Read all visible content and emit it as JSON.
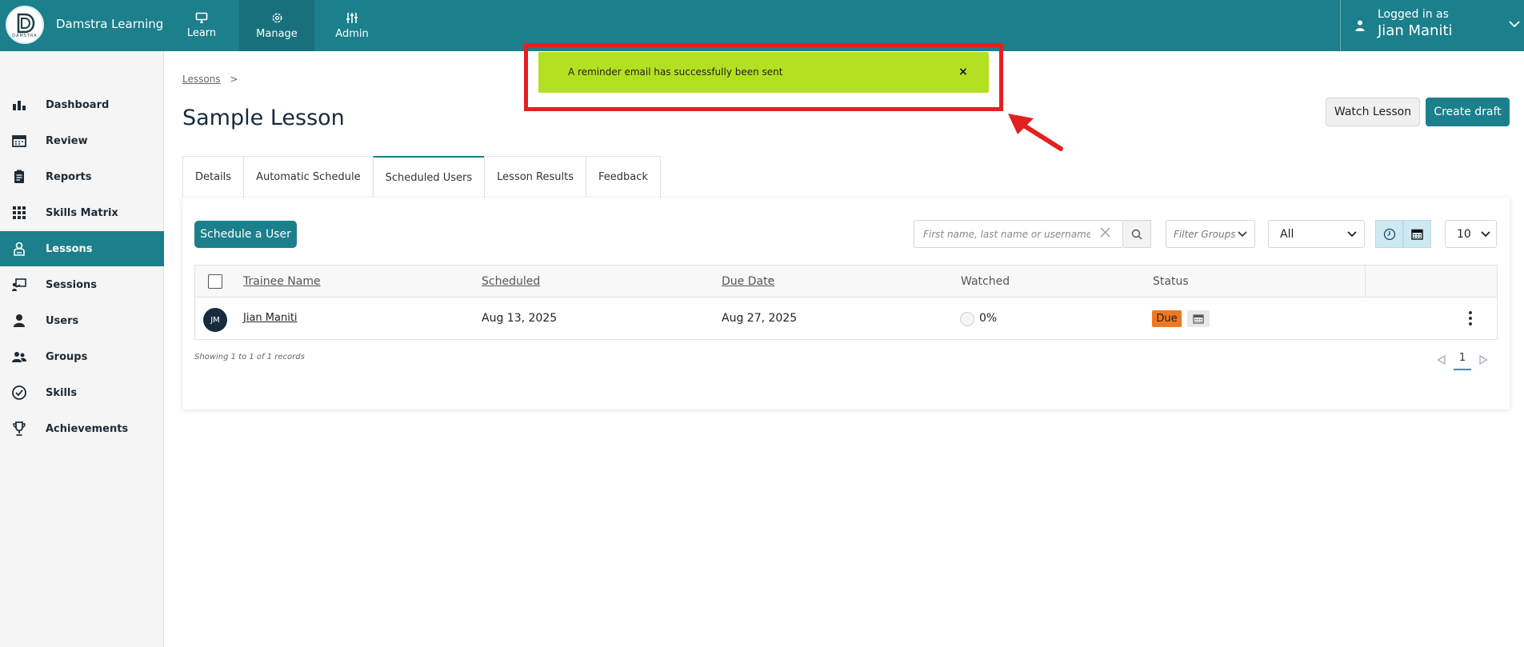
{
  "app": {
    "brand_name": "Damstra Learning",
    "logo_text": "DAMSTRA",
    "accent_color": "#1b7f8c"
  },
  "topnav": {
    "items": [
      {
        "label": "Learn",
        "icon": "monitor-icon",
        "active": false
      },
      {
        "label": "Manage",
        "icon": "gear-icon",
        "active": true
      },
      {
        "label": "Admin",
        "icon": "sliders-icon",
        "active": false
      }
    ]
  },
  "user": {
    "logged_in_label": "Logged in as",
    "name": "Jian Maniti"
  },
  "sidebar": {
    "items": [
      {
        "label": "Dashboard",
        "icon": "bar-chart-icon",
        "active": false
      },
      {
        "label": "Review",
        "icon": "calendar-icon",
        "active": false
      },
      {
        "label": "Reports",
        "icon": "clipboard-icon",
        "active": false
      },
      {
        "label": "Skills Matrix",
        "icon": "grid-icon",
        "active": false
      },
      {
        "label": "Lessons",
        "icon": "lesson-icon",
        "active": true
      },
      {
        "label": "Sessions",
        "icon": "presentation-icon",
        "active": false
      },
      {
        "label": "Users",
        "icon": "user-icon",
        "active": false
      },
      {
        "label": "Groups",
        "icon": "group-icon",
        "active": false
      },
      {
        "label": "Skills",
        "icon": "check-circle-icon",
        "active": false
      },
      {
        "label": "Achievements",
        "icon": "trophy-icon",
        "active": false
      }
    ]
  },
  "breadcrumb": {
    "link": "Lessons",
    "separator": ">"
  },
  "page": {
    "title": "Sample Lesson",
    "watch_button": "Watch Lesson",
    "create_button": "Create draft"
  },
  "tabs": [
    {
      "label": "Details",
      "active": false
    },
    {
      "label": "Automatic Schedule",
      "active": false
    },
    {
      "label": "Scheduled Users",
      "active": true
    },
    {
      "label": "Lesson Results",
      "active": false
    },
    {
      "label": "Feedback",
      "active": false
    }
  ],
  "toolbar": {
    "schedule_button": "Schedule a User",
    "search_placeholder": "First name, last name or username",
    "search_value": "",
    "filter_groups_placeholder": "Filter Groups",
    "status_select": "All",
    "page_size": "10"
  },
  "table": {
    "columns": [
      "Trainee Name",
      "Scheduled",
      "Due Date",
      "Watched",
      "Status"
    ],
    "sort_indicator": "^",
    "rows": [
      {
        "initials": "JM",
        "trainee": "Jian Maniti",
        "scheduled": "Aug 13, 2025",
        "due_date": "Aug 27, 2025",
        "watched": "0%",
        "status": "Due"
      }
    ]
  },
  "footer": {
    "records_text": "Showing 1 to 1 of 1 records",
    "current_page": "1"
  },
  "toast": {
    "message": "A reminder email has successfully been sent",
    "close": "×",
    "color": "#b3e020"
  },
  "annotation": {
    "color": "#e32020"
  }
}
